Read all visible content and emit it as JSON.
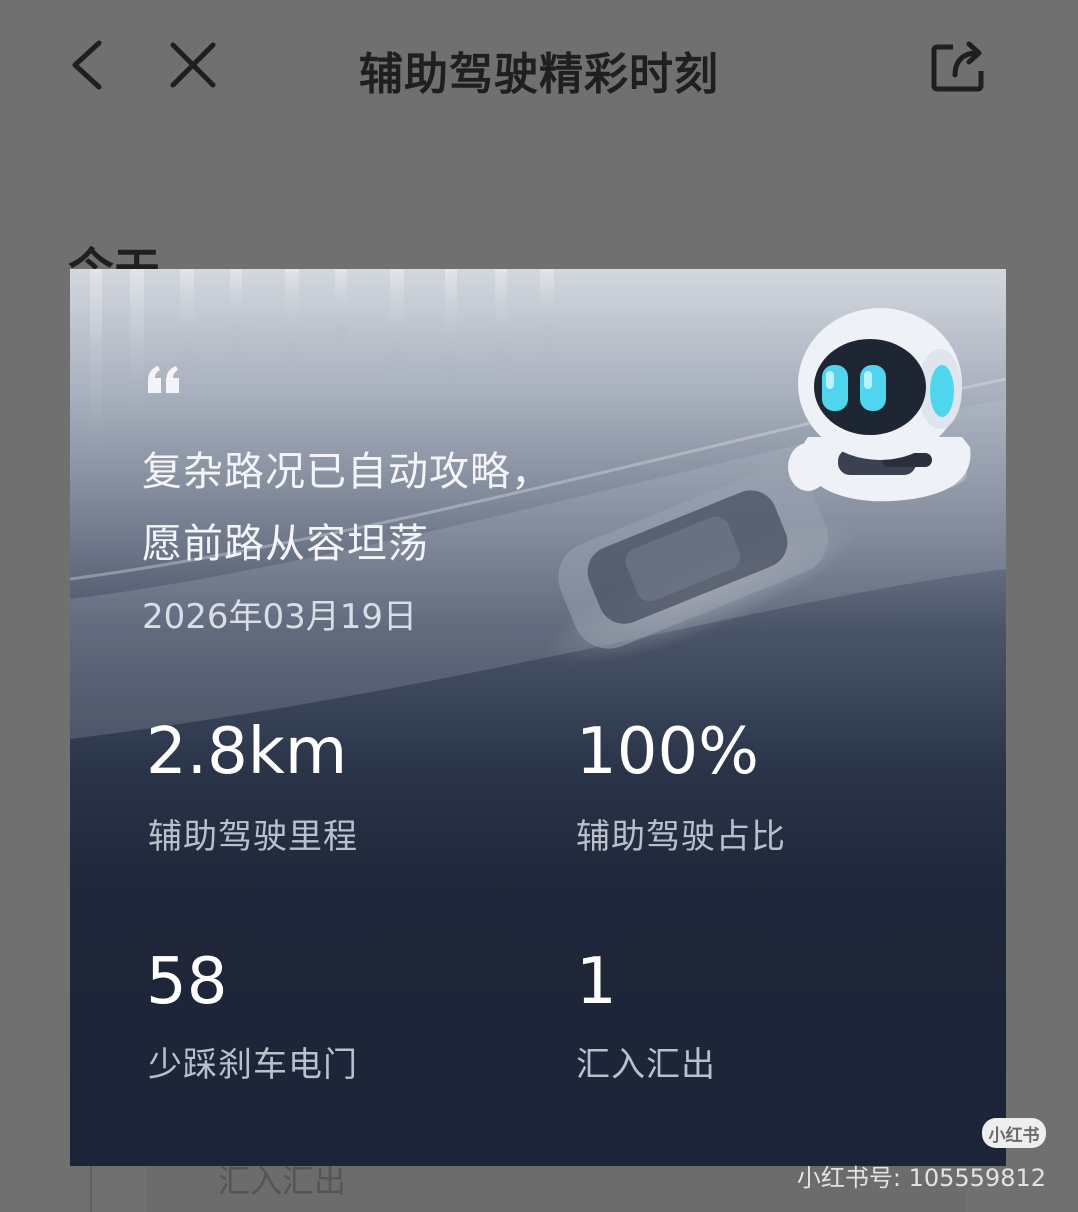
{
  "nav": {
    "title": "辅助驾驶精彩时刻",
    "back_icon": "chevron-left-icon",
    "close_icon": "close-icon",
    "share_icon": "share-icon"
  },
  "background": {
    "heading": "今天",
    "row_text": "汇入汇出"
  },
  "card": {
    "quote_icon": "quote-icon",
    "quote_line1": "复杂路况已自动攻略，",
    "quote_line2": "愿前路从容坦荡",
    "date": "2026年03月19日",
    "stats": [
      {
        "value": "2.8km",
        "label": "辅助驾驶里程"
      },
      {
        "value": "100%",
        "label": "辅助驾驶占比"
      },
      {
        "value": "58",
        "label": "少踩刹车电门"
      },
      {
        "value": "1",
        "label": "汇入汇出"
      }
    ],
    "colors": {
      "accent": "#4fd6ee",
      "card_bottom": "#1c2437"
    }
  },
  "watermark": {
    "logo": "小红书",
    "text": "小红书号: 105559812"
  }
}
